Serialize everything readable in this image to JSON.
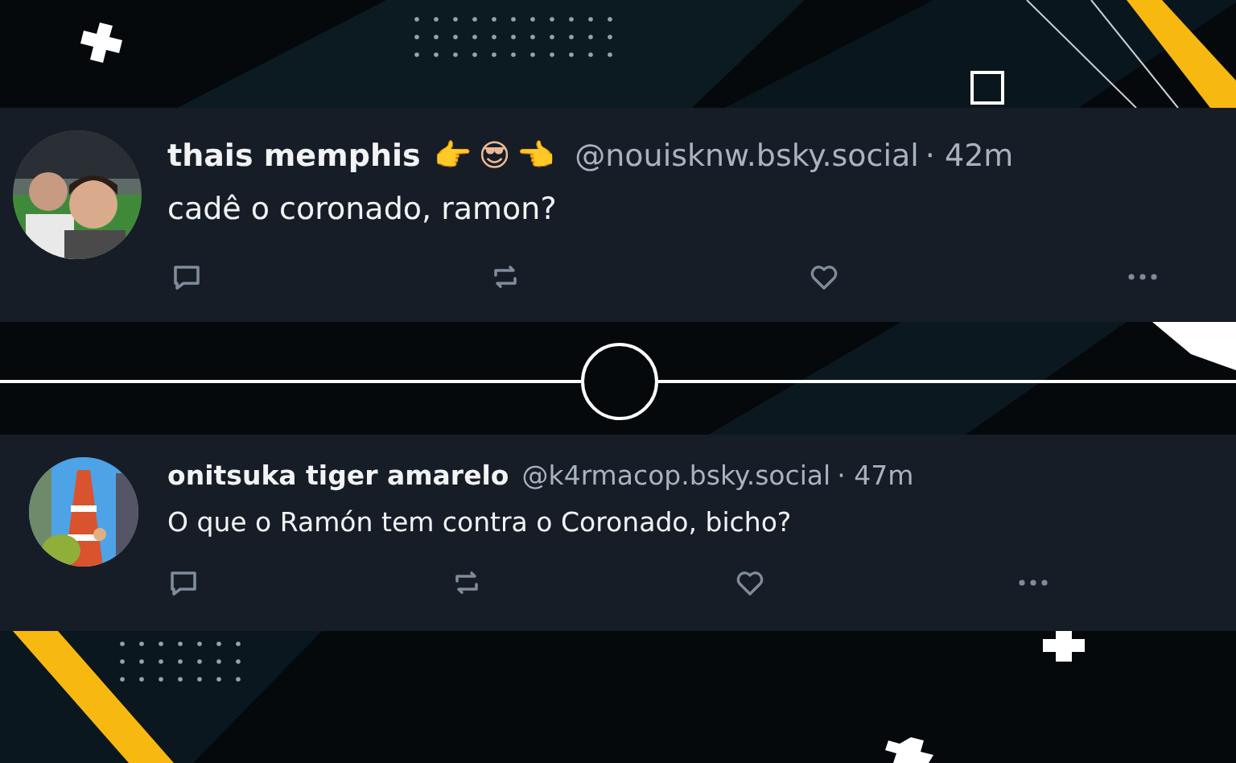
{
  "posts": [
    {
      "display_name": "thais memphis",
      "name_emoji": "👉😎👈",
      "handle": "@nouisknw.bsky.social",
      "separator": "·",
      "time": "42m",
      "text": "cadê o coronado, ramon?"
    },
    {
      "display_name": "onitsuka tiger amarelo",
      "handle": "@k4rmacop.bsky.social",
      "separator": "·",
      "time": "47m",
      "text": "O que o Ramón tem contra o Coronado, bicho?"
    }
  ]
}
